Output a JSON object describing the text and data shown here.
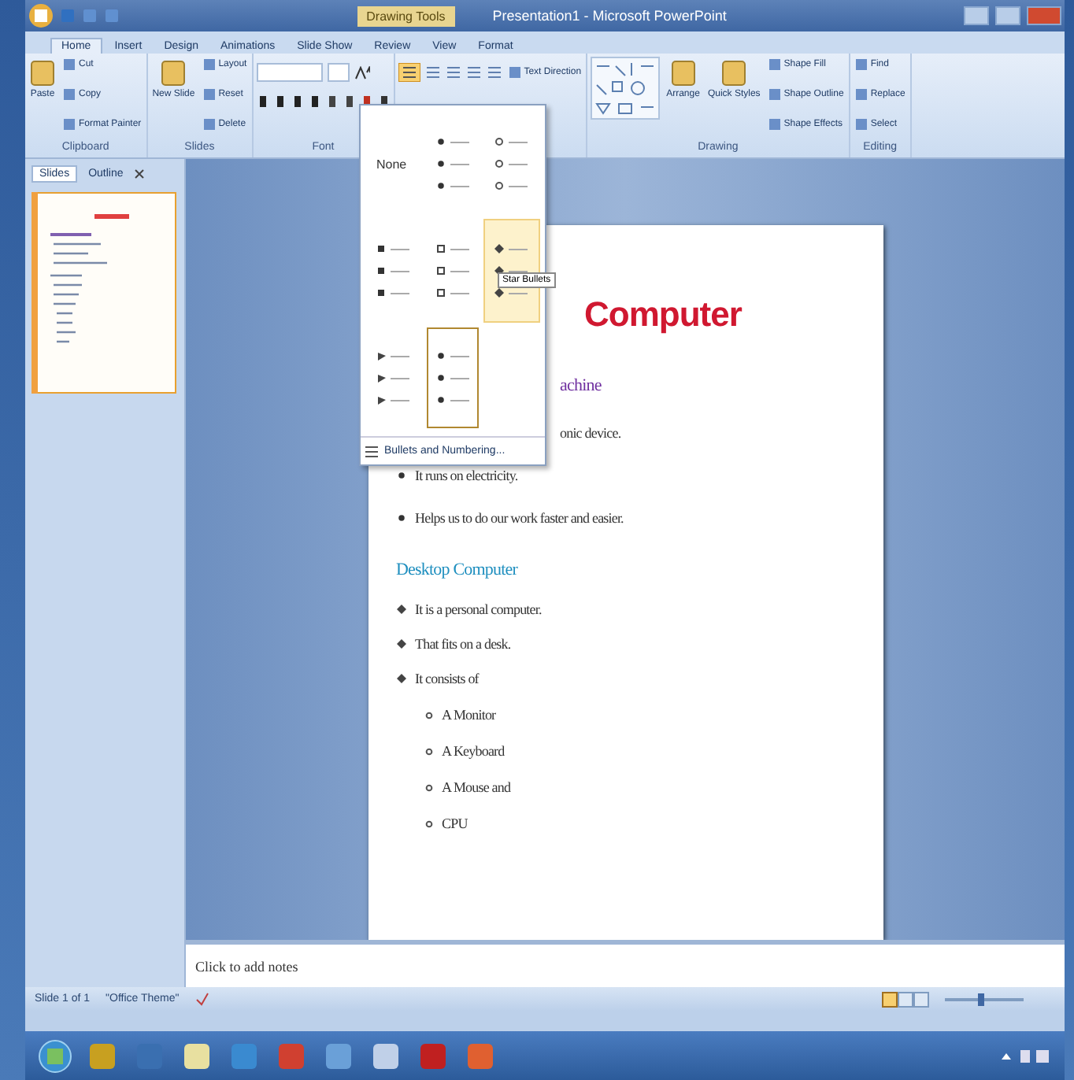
{
  "window": {
    "title": "Presentation1 - Microsoft PowerPoint",
    "context_tab": "Drawing Tools"
  },
  "ribbon_tabs": [
    {
      "label": "Home",
      "selected": true
    },
    {
      "label": "Insert",
      "selected": false
    },
    {
      "label": "Design",
      "selected": false
    },
    {
      "label": "Animations",
      "selected": false
    },
    {
      "label": "Slide Show",
      "selected": false
    },
    {
      "label": "Review",
      "selected": false
    },
    {
      "label": "View",
      "selected": false
    },
    {
      "label": "Format",
      "selected": false
    }
  ],
  "ribbon_groups": [
    {
      "label": "Clipboard",
      "items": [
        {
          "kind": "large",
          "label": "Paste"
        },
        {
          "kind": "small",
          "label": "Cut"
        },
        {
          "kind": "small",
          "label": "Copy"
        },
        {
          "kind": "small",
          "label": "Format Painter"
        }
      ]
    },
    {
      "label": "Slides",
      "items": [
        {
          "kind": "large",
          "label": "New Slide"
        },
        {
          "kind": "small",
          "label": "Layout"
        },
        {
          "kind": "small",
          "label": "Reset"
        },
        {
          "kind": "small",
          "label": "Delete"
        }
      ]
    },
    {
      "label": "Font",
      "items": [
        {
          "kind": "font"
        }
      ]
    },
    {
      "items": [
        {
          "kind": "paragraph",
          "label": "Text Direction"
        }
      ]
    },
    {
      "label": "Drawing",
      "items": [
        {
          "kind": "shapes"
        },
        {
          "kind": "large",
          "label": "Arrange"
        },
        {
          "kind": "large",
          "label": "Quick Styles"
        },
        {
          "kind": "small",
          "label": "Shape Fill"
        },
        {
          "kind": "small",
          "label": "Shape Outline"
        },
        {
          "kind": "small",
          "label": "Shape Effects"
        }
      ]
    },
    {
      "label": "Editing",
      "items": [
        {
          "kind": "small",
          "label": "Find"
        },
        {
          "kind": "small",
          "label": "Replace"
        },
        {
          "kind": "small",
          "label": "Select"
        }
      ]
    }
  ],
  "bullet_menu": {
    "cells": [
      {
        "kind": "none",
        "label": "None",
        "selected": false,
        "hovered": false
      },
      {
        "kind": "dot",
        "selected": false,
        "hovered": false
      },
      {
        "kind": "ring",
        "selected": false,
        "hovered": false
      },
      {
        "kind": "square",
        "selected": false,
        "hovered": false
      },
      {
        "kind": "hollow-square",
        "selected": false,
        "hovered": false
      },
      {
        "kind": "star",
        "selected": false,
        "hovered": true
      },
      {
        "kind": "arrow",
        "selected": false,
        "hovered": false
      },
      {
        "kind": "dot",
        "selected": true,
        "hovered": false
      }
    ],
    "tooltip": "Star Bullets",
    "footer": "Bullets and Numbering..."
  },
  "left_pane": {
    "tabs": [
      {
        "label": "Slides",
        "selected": true
      },
      {
        "label": "Outline",
        "selected": false
      }
    ]
  },
  "slide": {
    "items": [
      {
        "kind": "title",
        "text": "Computer"
      },
      {
        "kind": "heading",
        "text": "achine",
        "color": "#7030a0",
        "covered": true
      },
      {
        "kind": "item",
        "text": "onic device.",
        "covered": true
      },
      {
        "kind": "item",
        "text": "It runs on electricity.",
        "bullet": {
          "kind": "dot"
        }
      },
      {
        "kind": "item",
        "text": "Helps us to do our work faster and easier.",
        "bullet": {
          "kind": "dot"
        }
      },
      {
        "kind": "heading",
        "text": "Desktop Computer",
        "color": "#1f8fbf"
      },
      {
        "kind": "item",
        "text": "It is a personal computer.",
        "bullet": {
          "kind": "star"
        }
      },
      {
        "kind": "item",
        "text": "That fits on a desk.",
        "bullet": {
          "kind": "star"
        }
      },
      {
        "kind": "item",
        "text": "It consists of",
        "bullet": {
          "kind": "star"
        }
      },
      {
        "kind": "subitem",
        "text": "A Monitor",
        "bullet": {
          "kind": "ring"
        }
      },
      {
        "kind": "subitem",
        "text": "A Keyboard",
        "bullet": {
          "kind": "ring"
        }
      },
      {
        "kind": "subitem",
        "text": "A Mouse and",
        "bullet": {
          "kind": "ring"
        }
      },
      {
        "kind": "subitem",
        "text": "CPU",
        "bullet": {
          "kind": "ring"
        }
      }
    ]
  },
  "notes": {
    "placeholder": "Click to add notes"
  },
  "status_bar": {
    "slide": "Slide 1 of 1",
    "theme": "\"Office Theme\"",
    "zoom": {
      "level": 0.45
    }
  },
  "taskbar": {
    "apps": [
      {
        "color": "#c8a020"
      },
      {
        "color": "#3a6fb0"
      },
      {
        "color": "#e8e0a0"
      },
      {
        "color": "#3a8ad0"
      },
      {
        "color": "#d04030"
      },
      {
        "color": "#6aa0d8"
      },
      {
        "color": "#c0d0e8"
      },
      {
        "color": "#c02020"
      },
      {
        "color": "#e06030"
      }
    ]
  }
}
